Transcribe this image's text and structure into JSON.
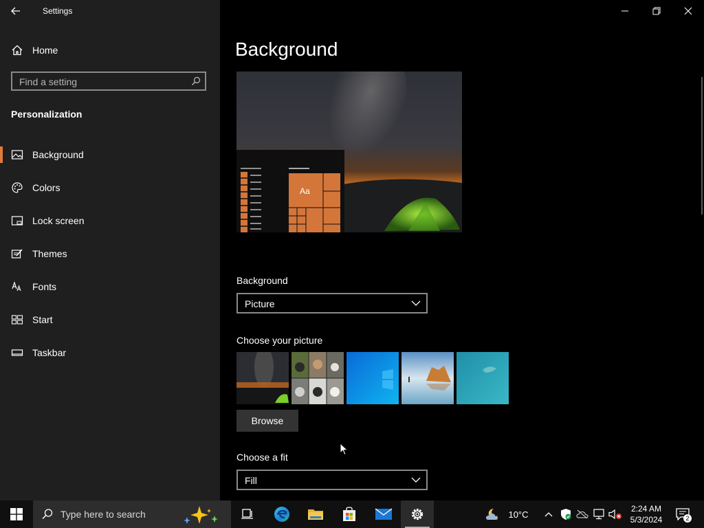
{
  "app": {
    "title": "Settings"
  },
  "sidebar": {
    "home_label": "Home",
    "search_placeholder": "Find a setting",
    "section_title": "Personalization",
    "items": [
      {
        "label": "Background",
        "icon": "image-icon",
        "active": true
      },
      {
        "label": "Colors",
        "icon": "palette-icon"
      },
      {
        "label": "Lock screen",
        "icon": "lock-screen-icon"
      },
      {
        "label": "Themes",
        "icon": "themes-icon"
      },
      {
        "label": "Fonts",
        "icon": "fonts-icon"
      },
      {
        "label": "Start",
        "icon": "start-icon"
      },
      {
        "label": "Taskbar",
        "icon": "taskbar-icon"
      }
    ]
  },
  "main": {
    "title": "Background",
    "preview_sample_text": "Aa",
    "background_label": "Background",
    "background_value": "Picture",
    "choose_picture_label": "Choose your picture",
    "browse_label": "Browse",
    "fit_label": "Choose a fit",
    "fit_value": "Fill"
  },
  "taskbar": {
    "search_placeholder": "Type here to search",
    "weather_temp": "10°C",
    "time": "2:24 AM",
    "date": "5/3/2024",
    "notification_count": "2"
  },
  "colors": {
    "accent": "#e07b39",
    "sidebar_bg": "#1f1f1f",
    "main_bg": "#000000",
    "taskbar_bg": "#101010"
  }
}
